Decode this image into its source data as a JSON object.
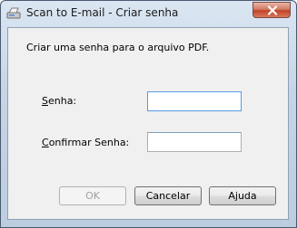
{
  "window": {
    "title": "Scan to E-mail - Criar senha"
  },
  "dialog": {
    "instruction": "Criar uma senha para o arquivo PDF.",
    "password_label_mnemonic": "S",
    "password_label_rest": "enha:",
    "confirm_label_mnemonic": "C",
    "confirm_label_rest": "onfirmar Senha:",
    "password_value": "",
    "confirm_value": ""
  },
  "buttons": {
    "ok": "OK",
    "cancel": "Cancelar",
    "help": "Ajuda"
  }
}
